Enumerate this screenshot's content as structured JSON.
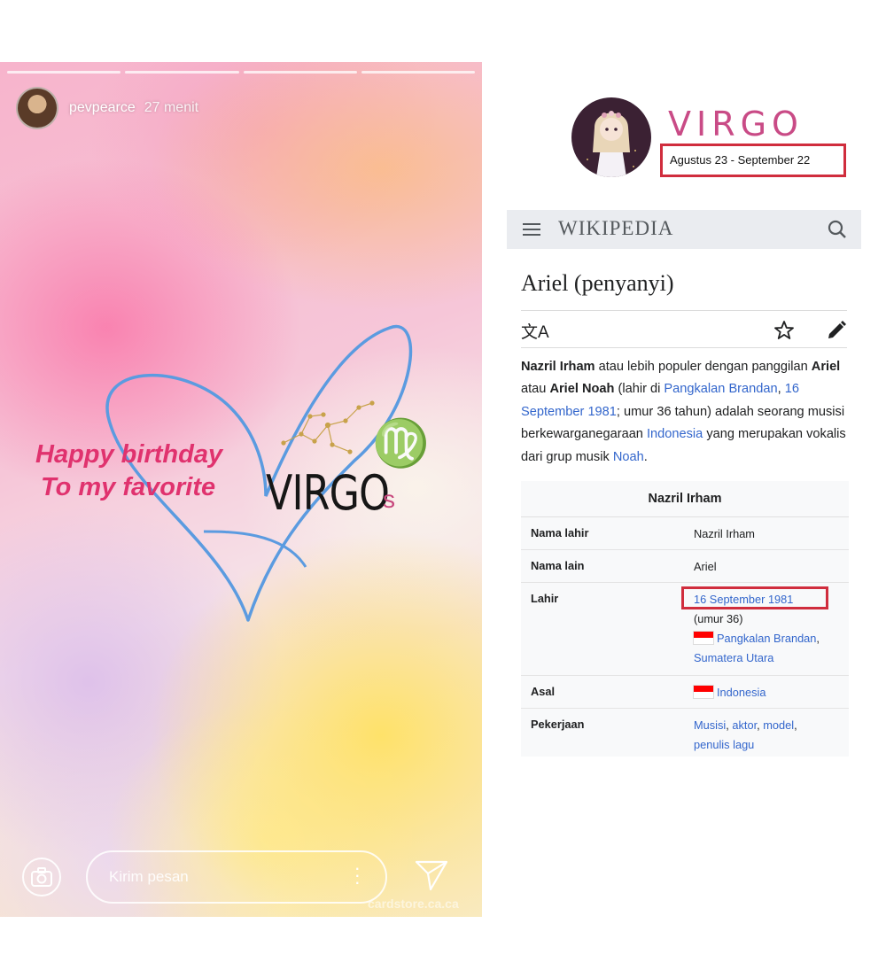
{
  "story": {
    "username": "pevpearce",
    "time_ago": "27 menit",
    "greeting_line1": "Happy birthday",
    "greeting_line2": "To my favorite",
    "virgo_text": "VIRGO",
    "virgo_suffix": "s",
    "zodiac_symbol": "♍",
    "message_placeholder": "Kirim pesan",
    "watermark": "cardstore.ca.ca",
    "icons": [
      "camera-icon",
      "more-icon",
      "send-icon"
    ]
  },
  "virgo_header": {
    "title": "VIRGO",
    "date_range": "Agustus 23 - September 22",
    "accent": "#c94b86",
    "highlight": "#d02d3d"
  },
  "wiki": {
    "logo": "WIKIPEDIA",
    "article_title": "Ariel (penyanyi)",
    "lang_icon": "文A",
    "intro": {
      "name_bold": "Nazril Irham",
      "t1": " atau lebih populer dengan panggilan ",
      "ariel": "Ariel",
      "t2": " atau ",
      "ariel_noah": "Ariel Noah",
      "t3": " (lahir di ",
      "birthplace_link": "Pangkalan Brandan",
      "t4": ", ",
      "birthdate_link": "16 September 1981",
      "t5": "; umur 36 tahun) adalah seorang musisi berkewarganegaraan ",
      "country_link": "Indonesia",
      "t6": " yang merupakan vokalis dari grup musik ",
      "band_link": "Noah",
      "t7": "."
    },
    "infobox": {
      "title": "Nazril Irham",
      "rows": [
        {
          "label": "Nama lahir",
          "value": "Nazril Irham"
        },
        {
          "label": "Nama lain",
          "value": "Ariel"
        },
        {
          "label": "Lahir",
          "date": "16 September 1981",
          "age": "(umur 36)",
          "place1": "Pangkalan Brandan",
          "place2": "Sumatera Utara"
        },
        {
          "label": "Asal",
          "value": "Indonesia"
        },
        {
          "label": "Pekerjaan",
          "jobs": [
            "Musisi",
            "aktor",
            "model",
            "penulis lagu"
          ]
        }
      ]
    }
  }
}
